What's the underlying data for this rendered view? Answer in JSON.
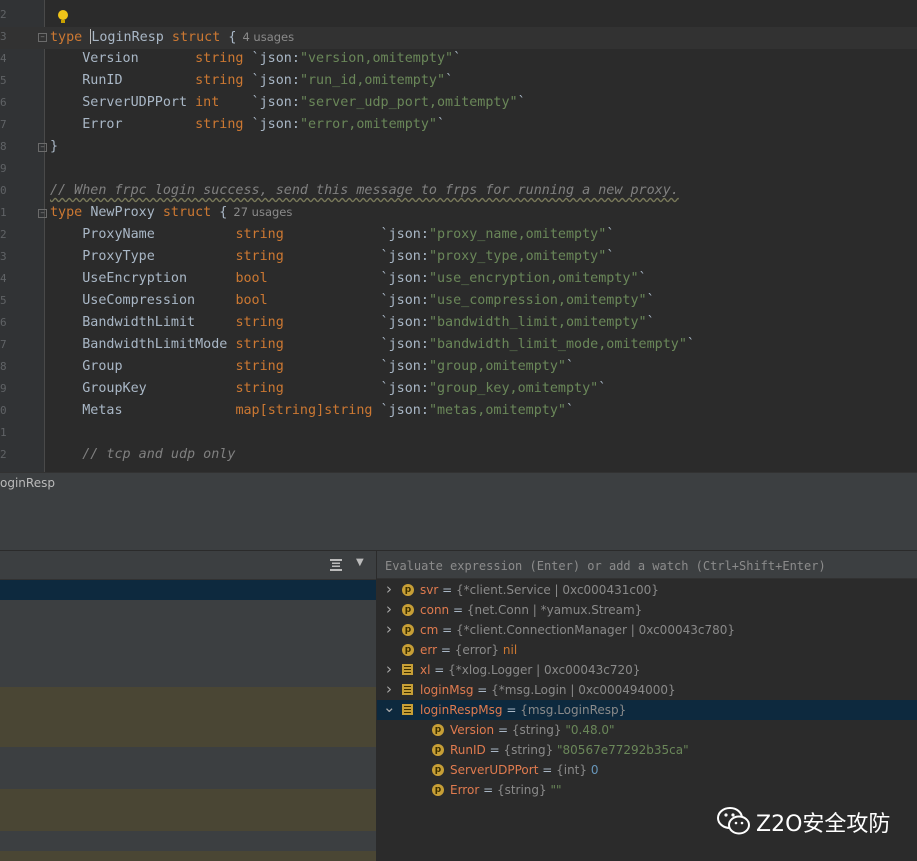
{
  "editor": {
    "lines": [
      {
        "num": "2",
        "tokens": []
      },
      {
        "num": "3",
        "current": true,
        "tokens": [
          {
            "t": "type ",
            "c": "kw"
          },
          {
            "t": "LoginResp",
            "c": "tn",
            "caret": true
          },
          {
            "t": " struct",
            "c": "kw"
          },
          {
            "t": " {",
            "c": "bt"
          }
        ],
        "usages": "4 usages"
      },
      {
        "num": "4",
        "tokens": [
          {
            "t": "    Version       ",
            "c": "bt"
          },
          {
            "t": "string",
            "c": "kw"
          },
          {
            "t": " `json:",
            "c": "bt"
          },
          {
            "t": "\"version,omitempty\"",
            "c": "str"
          },
          {
            "t": "`",
            "c": "bt"
          }
        ]
      },
      {
        "num": "5",
        "tokens": [
          {
            "t": "    RunID         ",
            "c": "bt"
          },
          {
            "t": "string",
            "c": "kw"
          },
          {
            "t": " `json:",
            "c": "bt"
          },
          {
            "t": "\"run_id,omitempty\"",
            "c": "str"
          },
          {
            "t": "`",
            "c": "bt"
          }
        ]
      },
      {
        "num": "6",
        "tokens": [
          {
            "t": "    ServerUDPPort ",
            "c": "bt"
          },
          {
            "t": "int",
            "c": "kw"
          },
          {
            "t": "    `json:",
            "c": "bt"
          },
          {
            "t": "\"server_udp_port,omitempty\"",
            "c": "str"
          },
          {
            "t": "`",
            "c": "bt"
          }
        ]
      },
      {
        "num": "7",
        "tokens": [
          {
            "t": "    Error         ",
            "c": "bt"
          },
          {
            "t": "string",
            "c": "kw"
          },
          {
            "t": " `json:",
            "c": "bt"
          },
          {
            "t": "\"error,omitempty\"",
            "c": "str"
          },
          {
            "t": "`",
            "c": "bt"
          }
        ]
      },
      {
        "num": "8",
        "tokens": [
          {
            "t": "}",
            "c": "bt"
          }
        ]
      },
      {
        "num": "9",
        "tokens": []
      },
      {
        "num": "0",
        "tokens": [
          {
            "t": "// When frpc login success, send this message to frps for running a new proxy.",
            "c": "cm squig"
          }
        ]
      },
      {
        "num": "1",
        "tokens": [
          {
            "t": "type ",
            "c": "kw"
          },
          {
            "t": "NewProxy",
            "c": "tn"
          },
          {
            "t": " struct",
            "c": "kw"
          },
          {
            "t": " {",
            "c": "bt"
          }
        ],
        "usages": "27 usages"
      },
      {
        "num": "2",
        "tokens": [
          {
            "t": "    ProxyName          ",
            "c": "bt"
          },
          {
            "t": "string",
            "c": "kw"
          },
          {
            "t": "            `json:",
            "c": "bt"
          },
          {
            "t": "\"proxy_name,omitempty\"",
            "c": "str"
          },
          {
            "t": "`",
            "c": "bt"
          }
        ]
      },
      {
        "num": "3",
        "tokens": [
          {
            "t": "    ProxyType          ",
            "c": "bt"
          },
          {
            "t": "string",
            "c": "kw"
          },
          {
            "t": "            `json:",
            "c": "bt"
          },
          {
            "t": "\"proxy_type,omitempty\"",
            "c": "str"
          },
          {
            "t": "`",
            "c": "bt"
          }
        ]
      },
      {
        "num": "4",
        "tokens": [
          {
            "t": "    UseEncryption      ",
            "c": "bt"
          },
          {
            "t": "bool",
            "c": "kw"
          },
          {
            "t": "              `json:",
            "c": "bt"
          },
          {
            "t": "\"use_encryption,omitempty\"",
            "c": "str"
          },
          {
            "t": "`",
            "c": "bt"
          }
        ]
      },
      {
        "num": "5",
        "tokens": [
          {
            "t": "    UseCompression     ",
            "c": "bt"
          },
          {
            "t": "bool",
            "c": "kw"
          },
          {
            "t": "              `json:",
            "c": "bt"
          },
          {
            "t": "\"use_compression,omitempty\"",
            "c": "str"
          },
          {
            "t": "`",
            "c": "bt"
          }
        ]
      },
      {
        "num": "6",
        "tokens": [
          {
            "t": "    BandwidthLimit     ",
            "c": "bt"
          },
          {
            "t": "string",
            "c": "kw"
          },
          {
            "t": "            `json:",
            "c": "bt"
          },
          {
            "t": "\"bandwidth_limit,omitempty\"",
            "c": "str"
          },
          {
            "t": "`",
            "c": "bt"
          }
        ]
      },
      {
        "num": "7",
        "tokens": [
          {
            "t": "    BandwidthLimitMode ",
            "c": "bt"
          },
          {
            "t": "string",
            "c": "kw"
          },
          {
            "t": "            `json:",
            "c": "bt"
          },
          {
            "t": "\"bandwidth_limit_mode,omitempty\"",
            "c": "str"
          },
          {
            "t": "`",
            "c": "bt"
          }
        ]
      },
      {
        "num": "8",
        "tokens": [
          {
            "t": "    Group              ",
            "c": "bt"
          },
          {
            "t": "string",
            "c": "kw"
          },
          {
            "t": "            `json:",
            "c": "bt"
          },
          {
            "t": "\"group,omitempty\"",
            "c": "str"
          },
          {
            "t": "`",
            "c": "bt"
          }
        ]
      },
      {
        "num": "9",
        "tokens": [
          {
            "t": "    GroupKey           ",
            "c": "bt"
          },
          {
            "t": "string",
            "c": "kw"
          },
          {
            "t": "            `json:",
            "c": "bt"
          },
          {
            "t": "\"group_key,omitempty\"",
            "c": "str"
          },
          {
            "t": "`",
            "c": "bt"
          }
        ]
      },
      {
        "num": "0",
        "tokens": [
          {
            "t": "    Metas              ",
            "c": "bt"
          },
          {
            "t": "map[",
            "c": "kw"
          },
          {
            "t": "string",
            "c": "kw"
          },
          {
            "t": "]",
            "c": "kw"
          },
          {
            "t": "string",
            "c": "kw"
          },
          {
            "t": " `json:",
            "c": "bt"
          },
          {
            "t": "\"metas,omitempty\"",
            "c": "str"
          },
          {
            "t": "`",
            "c": "bt"
          }
        ]
      },
      {
        "num": "1",
        "tokens": []
      },
      {
        "num": "2",
        "tokens": [
          {
            "t": "    // tcp and udp only",
            "c": "cm"
          }
        ]
      }
    ]
  },
  "breadcrumb": "oginResp",
  "evaluate": {
    "placeholder": "Evaluate expression (Enter) or add a watch (Ctrl+Shift+Enter)"
  },
  "variables": [
    {
      "icon": "p",
      "expand": "collapsed",
      "indent": 0,
      "name": "svr",
      "type": "{*client.Service | 0xc000431c00}",
      "value": "",
      "vclass": ""
    },
    {
      "icon": "p",
      "expand": "collapsed",
      "indent": 0,
      "name": "conn",
      "type": "{net.Conn | *yamux.Stream}",
      "value": "",
      "vclass": ""
    },
    {
      "icon": "p",
      "expand": "collapsed",
      "indent": 0,
      "name": "cm",
      "type": "{*client.ConnectionManager | 0xc00043c780}",
      "value": "",
      "vclass": ""
    },
    {
      "icon": "p",
      "expand": "none",
      "indent": 0,
      "name": "err",
      "type": "{error}",
      "value": " nil",
      "vclass": "vkw"
    },
    {
      "icon": "f",
      "expand": "collapsed",
      "indent": 0,
      "name": "xl",
      "type": "{*xlog.Logger | 0xc00043c720}",
      "value": "",
      "vclass": ""
    },
    {
      "icon": "f",
      "expand": "collapsed",
      "indent": 0,
      "name": "loginMsg",
      "type": "{*msg.Login | 0xc000494000}",
      "value": "",
      "vclass": ""
    },
    {
      "icon": "f",
      "expand": "expanded",
      "indent": 0,
      "name": "loginRespMsg",
      "type": "{msg.LoginResp}",
      "value": "",
      "vclass": "",
      "selected": true
    },
    {
      "icon": "p",
      "expand": "none",
      "indent": 1,
      "name": "Version",
      "type": "{string}",
      "value": " \"0.48.0\"",
      "vclass": "vstr"
    },
    {
      "icon": "p",
      "expand": "none",
      "indent": 1,
      "name": "RunID",
      "type": "{string}",
      "value": " \"80567e77292b35ca\"",
      "vclass": "vstr"
    },
    {
      "icon": "p",
      "expand": "none",
      "indent": 1,
      "name": "ServerUDPPort",
      "type": "{int}",
      "value": " 0",
      "vclass": "vnum"
    },
    {
      "icon": "p",
      "expand": "none",
      "indent": 1,
      "name": "Error",
      "type": "{string}",
      "value": " \"\"",
      "vclass": "vstr"
    }
  ],
  "watermark": "Z2O安全攻防",
  "colors": {
    "keyword": "#cc7832",
    "string": "#6a8759",
    "selection": "#0d293e",
    "icon": "#c79f36"
  }
}
